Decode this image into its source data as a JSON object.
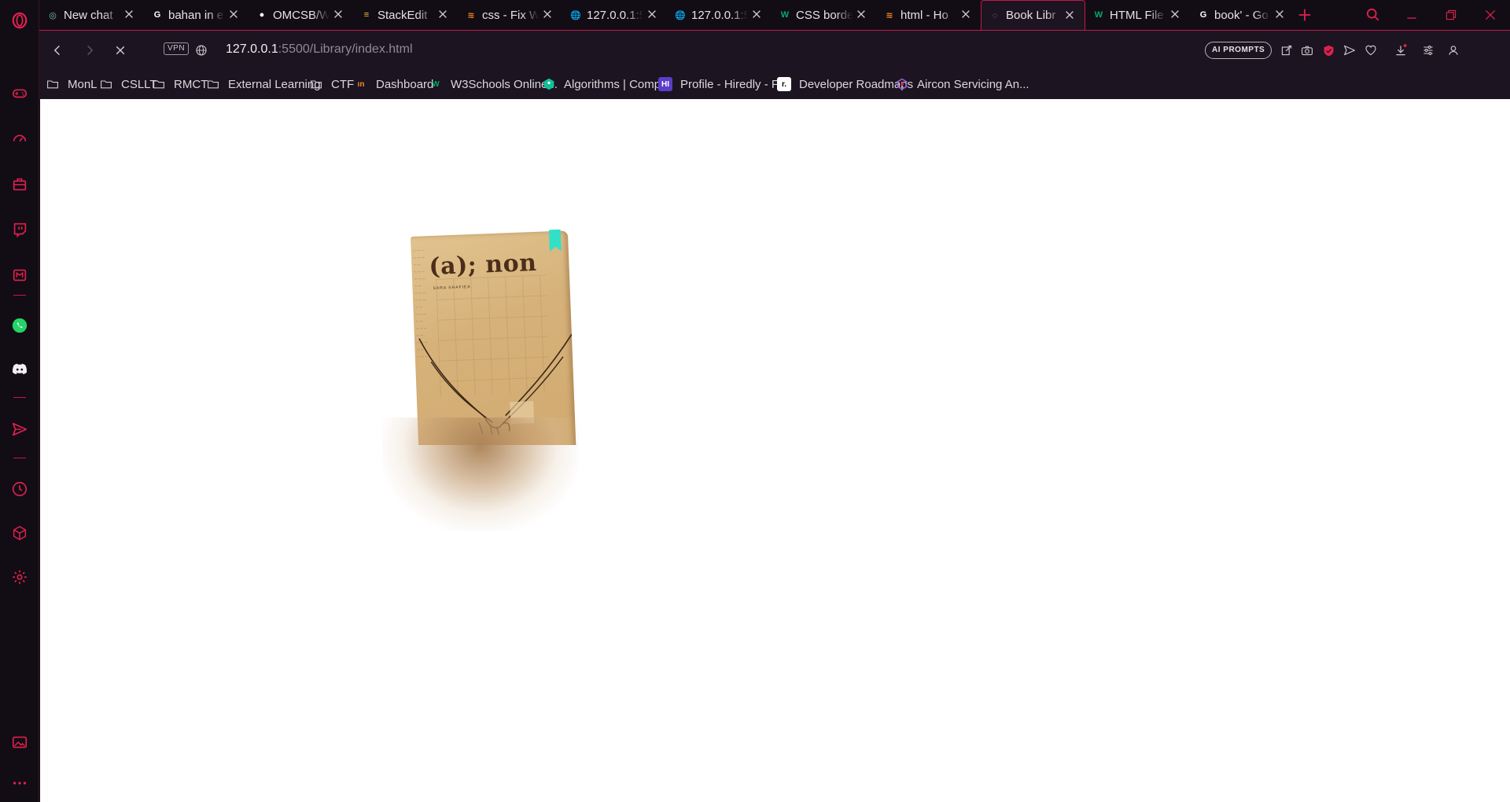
{
  "browser": {
    "tabs": [
      {
        "title": "New chat",
        "favicon": "chatgpt-icon",
        "color": "#7fbfae",
        "glyph": "◎"
      },
      {
        "title": "bahan in e",
        "favicon": "google-icon",
        "color": "#ffffff",
        "glyph": "G"
      },
      {
        "title": "OMCSB/W",
        "favicon": "github-icon",
        "color": "#ffffff",
        "glyph": "●"
      },
      {
        "title": "StackEdit",
        "favicon": "stackedit-icon",
        "color": "#f4c430",
        "glyph": "≡"
      },
      {
        "title": "css - Fix W",
        "favicon": "stackoverflow-icon",
        "color": "#f48024",
        "glyph": "≋"
      },
      {
        "title": "127.0.0.1:5",
        "favicon": "globe-icon",
        "color": "#e6e2e8",
        "glyph": "🌐"
      },
      {
        "title": "127.0.0.1:5",
        "favicon": "globe-icon",
        "color": "#e6e2e8",
        "glyph": "🌐"
      },
      {
        "title": "CSS borde",
        "favicon": "w3schools-icon",
        "color": "#04aa6d",
        "glyph": "W"
      },
      {
        "title": "html - Ho",
        "favicon": "stackoverflow-icon",
        "color": "#f48024",
        "glyph": "≋"
      },
      {
        "title": "Book Libr",
        "favicon": "loading-spinner-icon",
        "color": "#9a96a0",
        "glyph": "◌"
      },
      {
        "title": "HTML File",
        "favicon": "w3schools-icon",
        "color": "#04aa6d",
        "glyph": "W"
      },
      {
        "title": "book' - Go",
        "favicon": "google-icon",
        "color": "#ffffff",
        "glyph": "G"
      }
    ],
    "active_tab_index": 9,
    "address": {
      "vpn_label": "VPN",
      "url_host": "127.0.0.1",
      "url_rest": ":5500/Library/index.html"
    },
    "ai_prompts_label": "AI PROMPTS",
    "bookmarks": [
      {
        "label": "MonL",
        "icon": "folder-icon"
      },
      {
        "label": "CSLLT",
        "icon": "folder-icon"
      },
      {
        "label": "RMCT",
        "icon": "folder-icon"
      },
      {
        "label": "External Learning",
        "icon": "folder-icon"
      },
      {
        "label": "CTF",
        "icon": "folder-icon"
      },
      {
        "label": "Dashboard",
        "icon": "dashboard-favicon-icon"
      },
      {
        "label": "W3Schools Online...",
        "icon": "w3schools-icon"
      },
      {
        "label": "Algorithms | Comp...",
        "icon": "khan-academy-icon"
      },
      {
        "label": "Profile - Hiredly - Fi...",
        "icon": "hiredly-icon"
      },
      {
        "label": "Developer Roadmaps",
        "icon": "roadmap-icon"
      },
      {
        "label": "Aircon Servicing An...",
        "icon": "aircon-icon"
      }
    ],
    "accent_color": "#c2184a"
  },
  "page": {
    "book": {
      "title": "(a); non",
      "author": "SARA SHAFIEA",
      "cover_color": "#d6b27a",
      "spine_color": "#4f5cc8",
      "ribbon_color": "#32e0c8"
    }
  }
}
